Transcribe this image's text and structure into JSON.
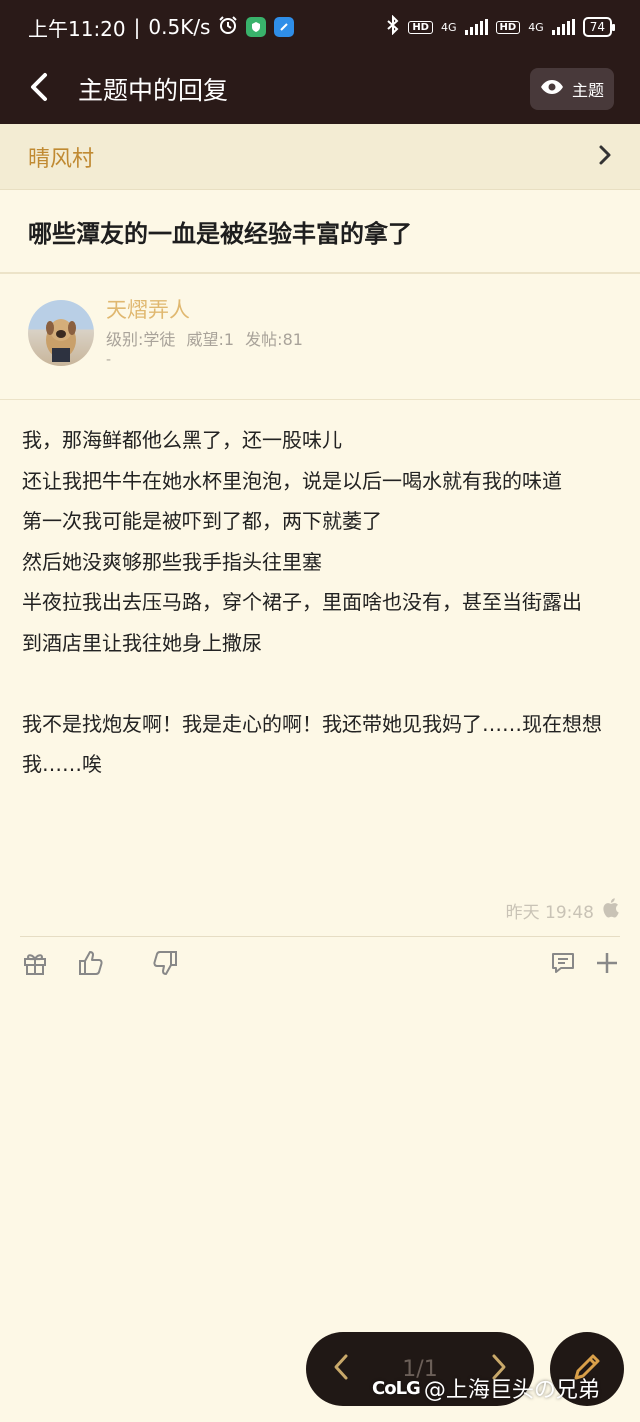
{
  "status_bar": {
    "time": "上午11:20",
    "net_speed": "0.5K/s",
    "hd1": "HD",
    "net1": "4G",
    "hd2": "HD",
    "net2": "4G",
    "battery": "74"
  },
  "navbar": {
    "title": "主题中的回复",
    "topic_button_label": "主题"
  },
  "forum": {
    "name": "晴风村"
  },
  "thread": {
    "title": "哪些潭友的一血是被经验丰富的拿了"
  },
  "author": {
    "name": "天熠弄人",
    "level": "级别:学徒",
    "prestige": "威望:1",
    "posts": "发帖:81",
    "signature": "-"
  },
  "post": {
    "lines": [
      "我，那海鲜都他么黑了，还一股味儿",
      "还让我把牛牛在她水杯里泡泡，说是以后一喝水就有我的味道",
      "第一次我可能是被吓到了都，两下就萎了",
      "然后她没爽够那些我手指头往里塞",
      "半夜拉我出去压马路，穿个裙子，里面啥也没有，甚至当街露出",
      "到酒店里让我往她身上撒尿",
      "",
      "我不是找炮友啊！我是走心的啊！我还带她见我妈了……现在想想我……唉"
    ],
    "time": "昨天 19:48",
    "device_icon": "apple-icon"
  },
  "pager": {
    "page": "1/1"
  },
  "watermark": {
    "logo": "CoLG",
    "text": "@上海巨头の兄弟"
  },
  "colors": {
    "header_bg": "#2a1a18",
    "page_bg": "#fdf8e6",
    "forum_name": "#c08a32",
    "author_name": "#e0b870"
  }
}
